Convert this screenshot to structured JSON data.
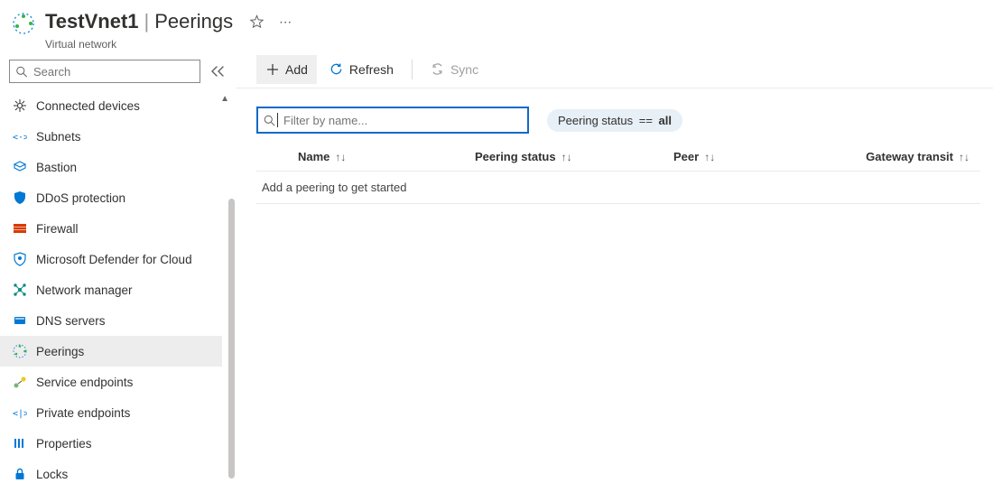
{
  "header": {
    "res_name": "TestVnet1",
    "page_name": "Peerings",
    "subtitle": "Virtual network"
  },
  "sidebar": {
    "search_placeholder": "Search",
    "items": [
      {
        "key": "connected-devices",
        "label": "Connected devices"
      },
      {
        "key": "subnets",
        "label": "Subnets"
      },
      {
        "key": "bastion",
        "label": "Bastion"
      },
      {
        "key": "ddos-protection",
        "label": "DDoS protection"
      },
      {
        "key": "firewall",
        "label": "Firewall"
      },
      {
        "key": "defender",
        "label": "Microsoft Defender for Cloud"
      },
      {
        "key": "network-manager",
        "label": "Network manager"
      },
      {
        "key": "dns-servers",
        "label": "DNS servers"
      },
      {
        "key": "peerings",
        "label": "Peerings"
      },
      {
        "key": "service-endpoints",
        "label": "Service endpoints"
      },
      {
        "key": "private-endpoints",
        "label": "Private endpoints"
      },
      {
        "key": "properties",
        "label": "Properties"
      },
      {
        "key": "locks",
        "label": "Locks"
      }
    ],
    "active_index": 8
  },
  "commands": {
    "add": "Add",
    "refresh": "Refresh",
    "sync": "Sync"
  },
  "filter": {
    "placeholder": "Filter by name...",
    "pill_field": "Peering status",
    "pill_op": "==",
    "pill_value": "all"
  },
  "table": {
    "columns": [
      "Name",
      "Peering status",
      "Peer",
      "Gateway transit"
    ],
    "empty_text": "Add a peering to get started"
  }
}
